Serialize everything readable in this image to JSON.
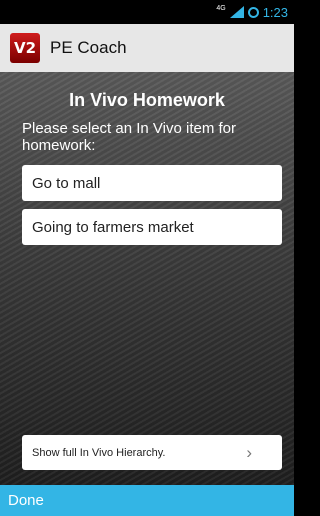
{
  "status_bar": {
    "network_label": "4G",
    "time": "1:23",
    "accent_color": "#33b5e5"
  },
  "app_bar": {
    "logo_icon": "pe-coach-logo",
    "title": "PE Coach"
  },
  "main": {
    "title": "In Vivo Homework",
    "instruction": "Please select an In Vivo item for homework:",
    "items": [
      {
        "label": "Go to mall"
      },
      {
        "label": "Going to farmers market"
      }
    ],
    "show_hierarchy_label": "Show full In Vivo Hierarchy."
  },
  "footer": {
    "done_label": "Done",
    "color": "#33b5e5"
  }
}
